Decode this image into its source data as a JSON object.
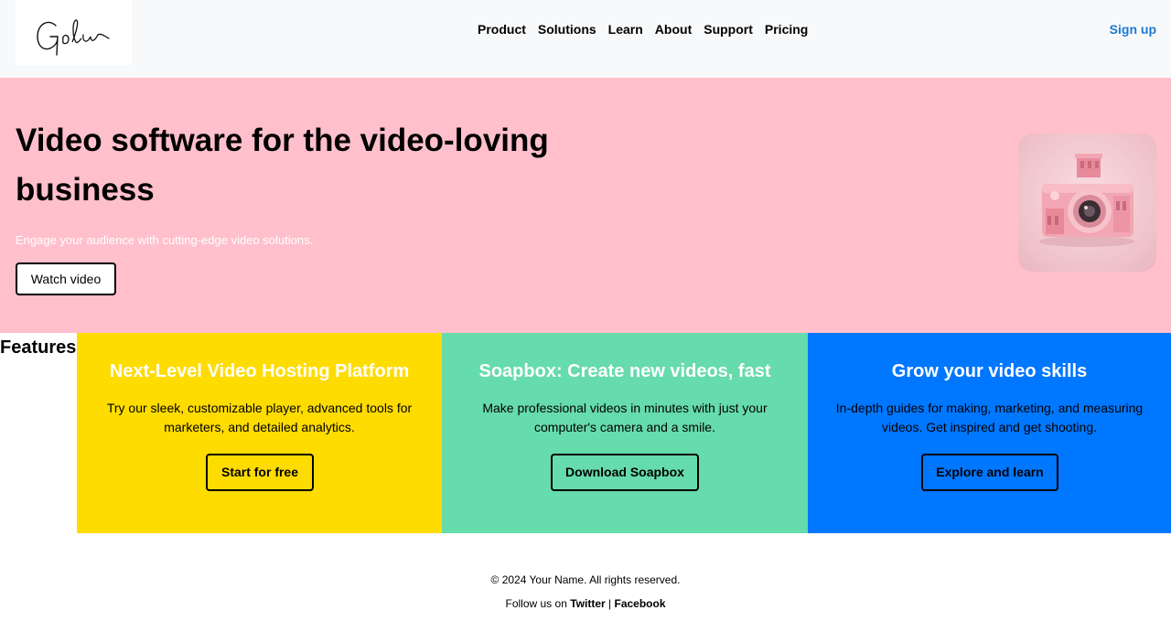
{
  "header": {
    "logo_text": "Golu",
    "nav": [
      "Product",
      "Solutions",
      "Learn",
      "About",
      "Support",
      "Pricing"
    ],
    "signup_label": "Sign up"
  },
  "hero": {
    "title": "Video software for the video-loving business",
    "subtitle": "Engage your audience with cutting-edge video solutions.",
    "button_label": "Watch video",
    "image_icon": "pink-camera-image"
  },
  "features": {
    "heading": "Features",
    "cards": [
      {
        "title": "Next-Level Video Hosting Platform",
        "description": "Try our sleek, customizable player, advanced tools for marketers, and detailed analytics.",
        "button_label": "Start for free",
        "color": "#ffdc00"
      },
      {
        "title": "Soapbox: Create new videos, fast",
        "description": "Make professional videos in minutes with just your computer's camera and a smile.",
        "button_label": "Download Soapbox",
        "color": "#66dbac"
      },
      {
        "title": "Grow your video skills",
        "description": "In-depth guides for making, marketing, and measuring videos. Get inspired and get shooting.",
        "button_label": "Explore and learn",
        "color": "#0077ff"
      }
    ]
  },
  "footer": {
    "copyright": "© 2024 Your Name. All rights reserved.",
    "follow_prefix": "Follow us on",
    "twitter_label": "Twitter",
    "separator": "|",
    "facebook_label": "Facebook"
  },
  "colors": {
    "header_bg": "#f8f9fa",
    "hero_bg": "#ffc0cb",
    "signup": "#1a7ad1"
  }
}
